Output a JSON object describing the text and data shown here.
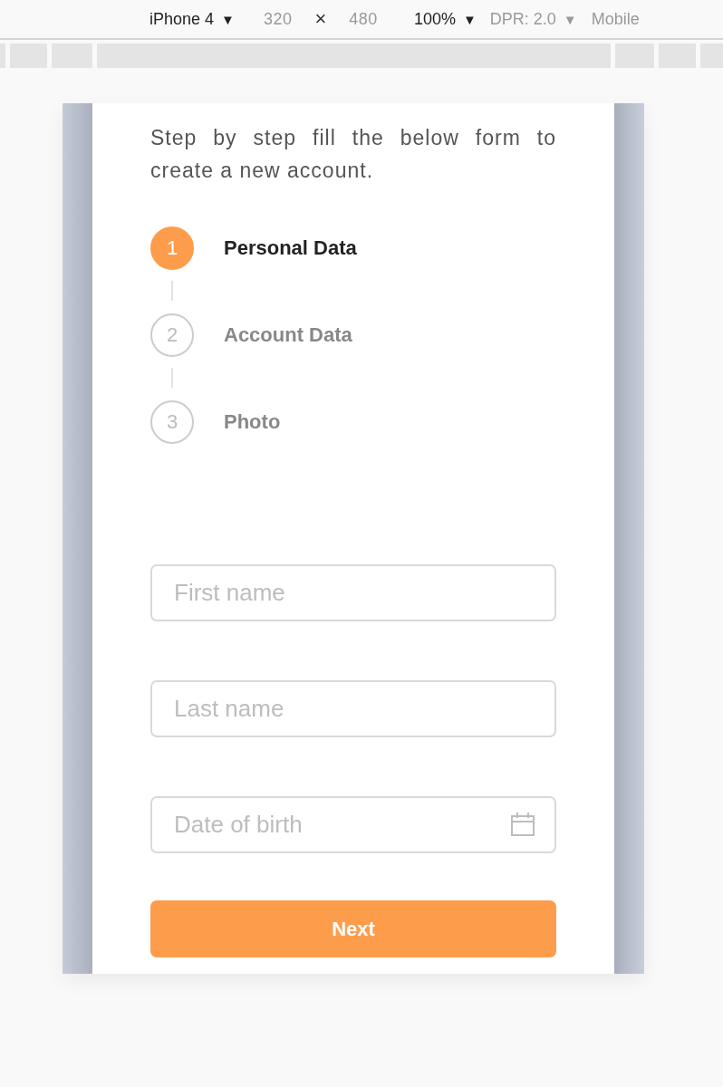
{
  "device_toolbar": {
    "items": [
      {
        "kind": "dropdown",
        "label": "iPhone 4",
        "caret": "▼",
        "disabled": false
      },
      {
        "kind": "field",
        "label": "320",
        "disabled": true
      },
      {
        "kind": "symbol",
        "label": "×",
        "disabled": false
      },
      {
        "kind": "field",
        "label": "480",
        "disabled": true
      },
      {
        "kind": "dropdown",
        "label": "100%",
        "caret": "▼",
        "disabled": false
      },
      {
        "kind": "dropdown",
        "label": "DPR: 2.0",
        "caret": "▼",
        "disabled": true
      },
      {
        "kind": "dropdown",
        "label": "Mobile",
        "disabled": true
      }
    ]
  },
  "form": {
    "intro": "Step by step fill the below form to create a new account.",
    "steps": [
      {
        "number": "1",
        "label": "Personal Data",
        "selected": true
      },
      {
        "number": "2",
        "label": "Account Data",
        "selected": false
      },
      {
        "number": "3",
        "label": "Photo",
        "selected": false
      }
    ],
    "fields": [
      {
        "placeholder": "First name",
        "kind": "text"
      },
      {
        "placeholder": "Last name",
        "kind": "text"
      },
      {
        "placeholder": "Date of birth",
        "kind": "date"
      }
    ],
    "button": "Next"
  }
}
